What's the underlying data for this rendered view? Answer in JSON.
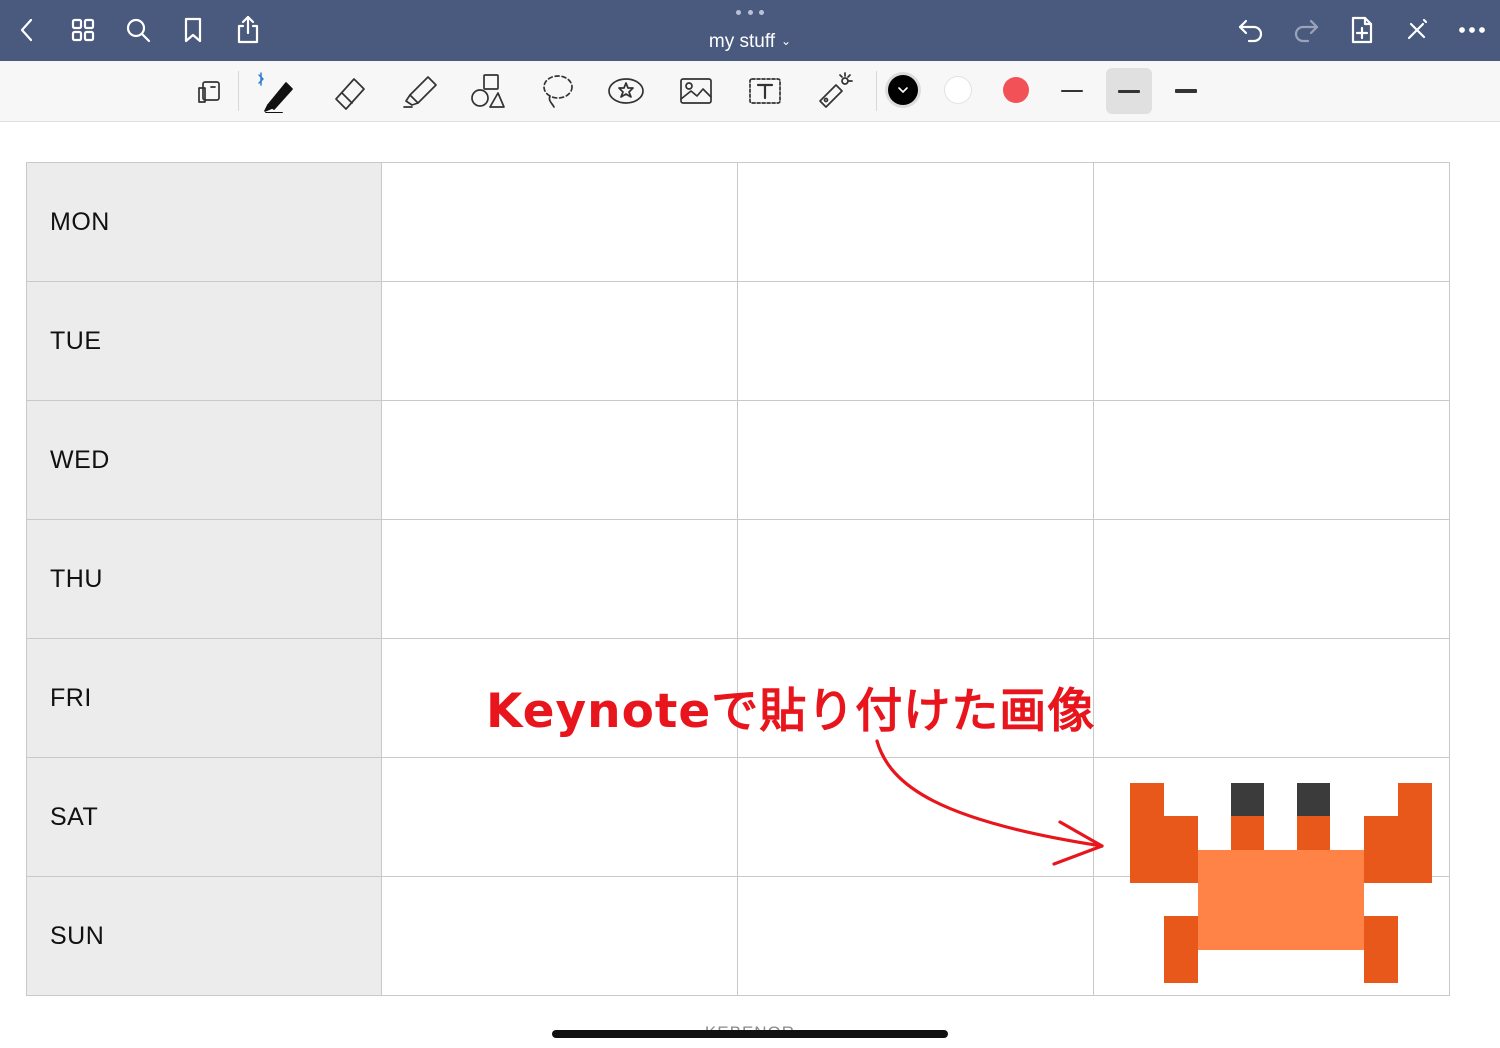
{
  "nav": {
    "title": "my stuff",
    "title_chevron": "⌄"
  },
  "colors": {
    "nav_bg": "#4a5a7e",
    "toolbar_bg": "#f7f7f7",
    "swatch_black": "#000000",
    "swatch_white": "#ffffff",
    "swatch_red": "#f25157",
    "annotation_red": "#e8161c",
    "crab_body": "#ff8247",
    "crab_limb": "#e8581b",
    "crab_eye": "#3b3b3b",
    "day_cell_bg": "#ececec"
  },
  "icons": {
    "nav_left": [
      "back-icon",
      "grid-icon",
      "search-icon",
      "bookmark-icon",
      "share-icon"
    ],
    "nav_right": [
      "undo-icon",
      "redo-icon",
      "add-page-icon",
      "close-toolbar-icon",
      "more-icon"
    ],
    "tools": [
      "readonly-mode-icon",
      "pen-icon",
      "eraser-icon",
      "highlighter-icon",
      "shapes-icon",
      "lasso-icon",
      "elements-icon",
      "image-icon",
      "text-icon",
      "laser-pointer-icon"
    ]
  },
  "planner": {
    "days": [
      "MON",
      "TUE",
      "WED",
      "THU",
      "FRI",
      "SAT",
      "SUN"
    ]
  },
  "annotation": {
    "text": "Keynoteで貼り付けた画像"
  },
  "footer": {
    "brand": "KEBENOR"
  }
}
